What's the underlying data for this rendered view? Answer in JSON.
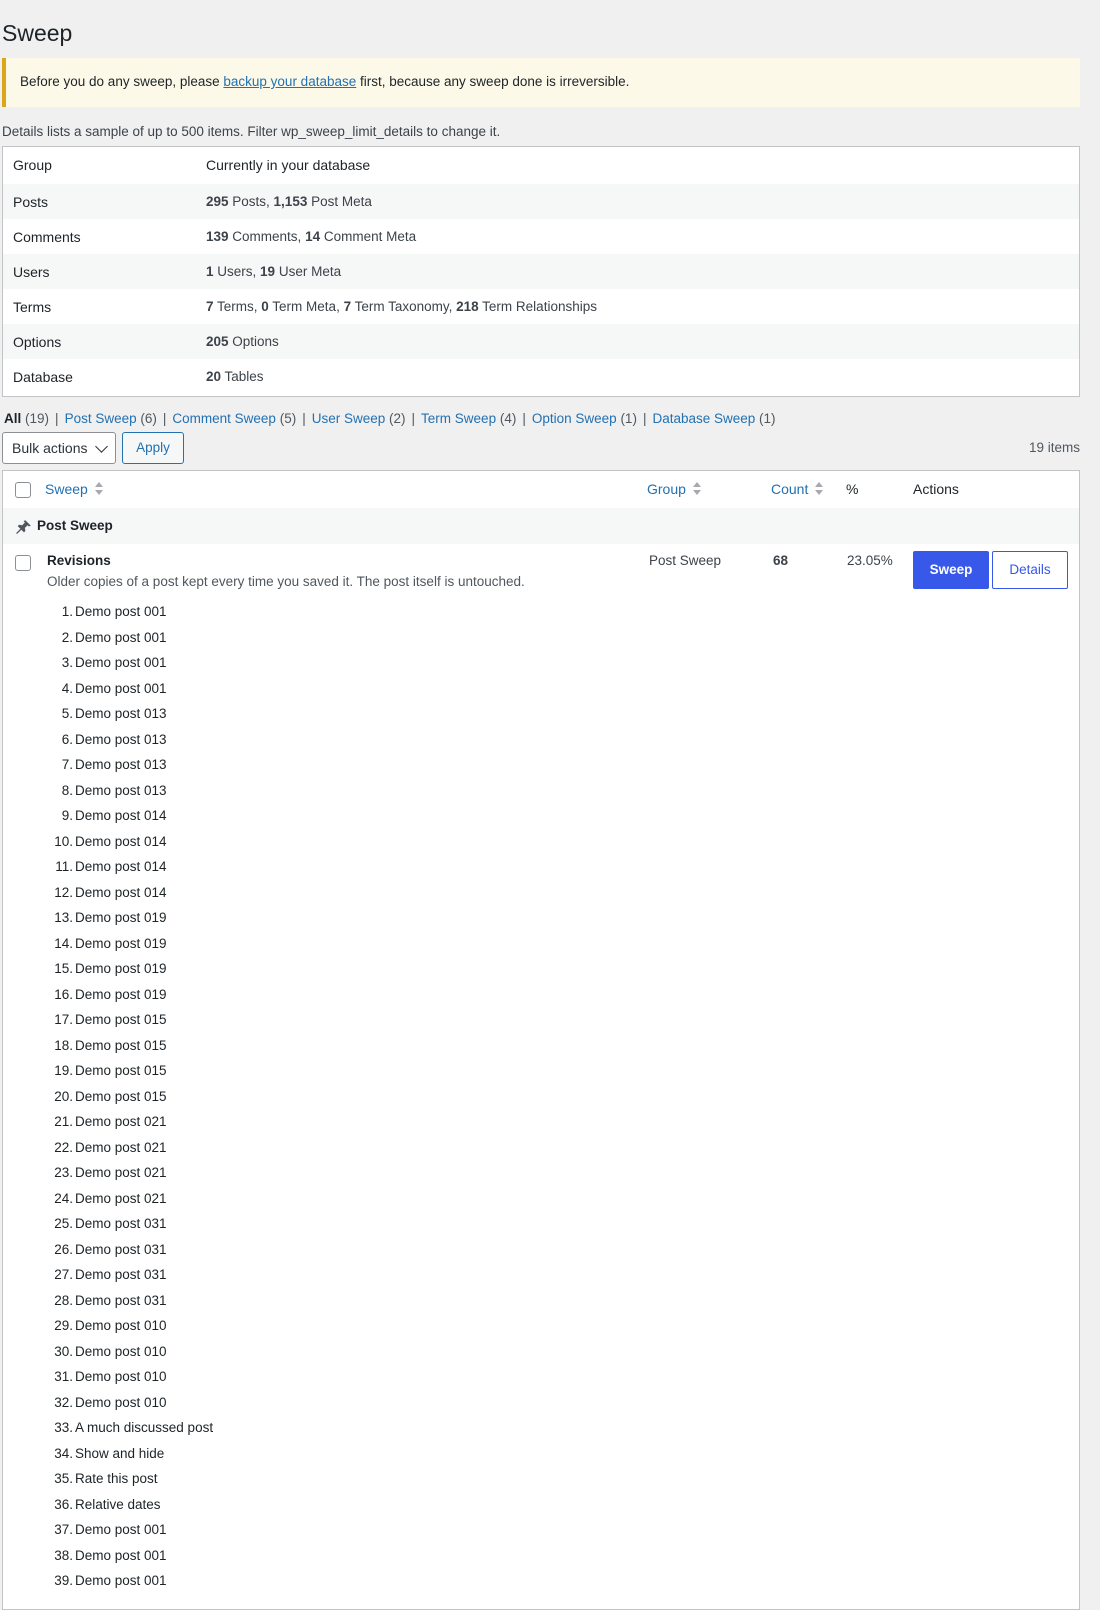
{
  "page": {
    "title": "Sweep"
  },
  "notice": {
    "before": "Before you do any sweep, please ",
    "link": "backup your database",
    "after": " first, because any sweep done is irreversible."
  },
  "details_note": "Details lists a sample of up to 500 items. Filter wp_sweep_limit_details to change it.",
  "summary": {
    "headers": [
      "Group",
      "Currently in your database"
    ],
    "rows": [
      {
        "group": "Posts",
        "parts": [
          [
            "295",
            " Posts, "
          ],
          [
            "1,153",
            " Post Meta"
          ]
        ]
      },
      {
        "group": "Comments",
        "parts": [
          [
            "139",
            " Comments, "
          ],
          [
            "14",
            " Comment Meta"
          ]
        ]
      },
      {
        "group": "Users",
        "parts": [
          [
            "1",
            " Users, "
          ],
          [
            "19",
            " User Meta"
          ]
        ]
      },
      {
        "group": "Terms",
        "parts": [
          [
            "7",
            " Terms, "
          ],
          [
            "0",
            " Term Meta, "
          ],
          [
            "7",
            " Term Taxonomy, "
          ],
          [
            "218",
            " Term Relationships"
          ]
        ]
      },
      {
        "group": "Options",
        "parts": [
          [
            "205",
            " Options"
          ]
        ]
      },
      {
        "group": "Database",
        "parts": [
          [
            "20",
            " Tables"
          ]
        ]
      }
    ]
  },
  "filters": [
    {
      "label": "All",
      "count": "(19)",
      "current": true
    },
    {
      "label": "Post Sweep",
      "count": "(6)"
    },
    {
      "label": "Comment Sweep",
      "count": "(5)"
    },
    {
      "label": "User Sweep",
      "count": "(2)"
    },
    {
      "label": "Term Sweep",
      "count": "(4)"
    },
    {
      "label": "Option Sweep",
      "count": "(1)"
    },
    {
      "label": "Database Sweep",
      "count": "(1)"
    }
  ],
  "bulk": {
    "select_label": "Bulk actions",
    "apply_label": "Apply",
    "items_count": "19 items"
  },
  "table": {
    "columns": {
      "sweep": "Sweep",
      "group": "Group",
      "count": "Count",
      "percent": "%",
      "actions": "Actions"
    },
    "group_label": "Post Sweep",
    "row": {
      "title": "Revisions",
      "description": "Older copies of a post kept every time you saved it. The post itself is untouched.",
      "group": "Post Sweep",
      "count": "68",
      "percent": "23.05%",
      "sweep_button": "Sweep",
      "details_button": "Details"
    },
    "details": [
      "Demo post 001",
      "Demo post 001",
      "Demo post 001",
      "Demo post 001",
      "Demo post 013",
      "Demo post 013",
      "Demo post 013",
      "Demo post 013",
      "Demo post 014",
      "Demo post 014",
      "Demo post 014",
      "Demo post 014",
      "Demo post 019",
      "Demo post 019",
      "Demo post 019",
      "Demo post 019",
      "Demo post 015",
      "Demo post 015",
      "Demo post 015",
      "Demo post 015",
      "Demo post 021",
      "Demo post 021",
      "Demo post 021",
      "Demo post 021",
      "Demo post 031",
      "Demo post 031",
      "Demo post 031",
      "Demo post 031",
      "Demo post 010",
      "Demo post 010",
      "Demo post 010",
      "Demo post 010",
      "A much discussed post",
      "Show and hide",
      "Rate this post",
      "Relative dates",
      "Demo post 001",
      "Demo post 001",
      "Demo post 001"
    ]
  },
  "colors": {
    "link": "#2271b1",
    "primary_button": "#3858e9",
    "notice_border": "#dba617",
    "notice_bg": "#fcf9e8"
  }
}
